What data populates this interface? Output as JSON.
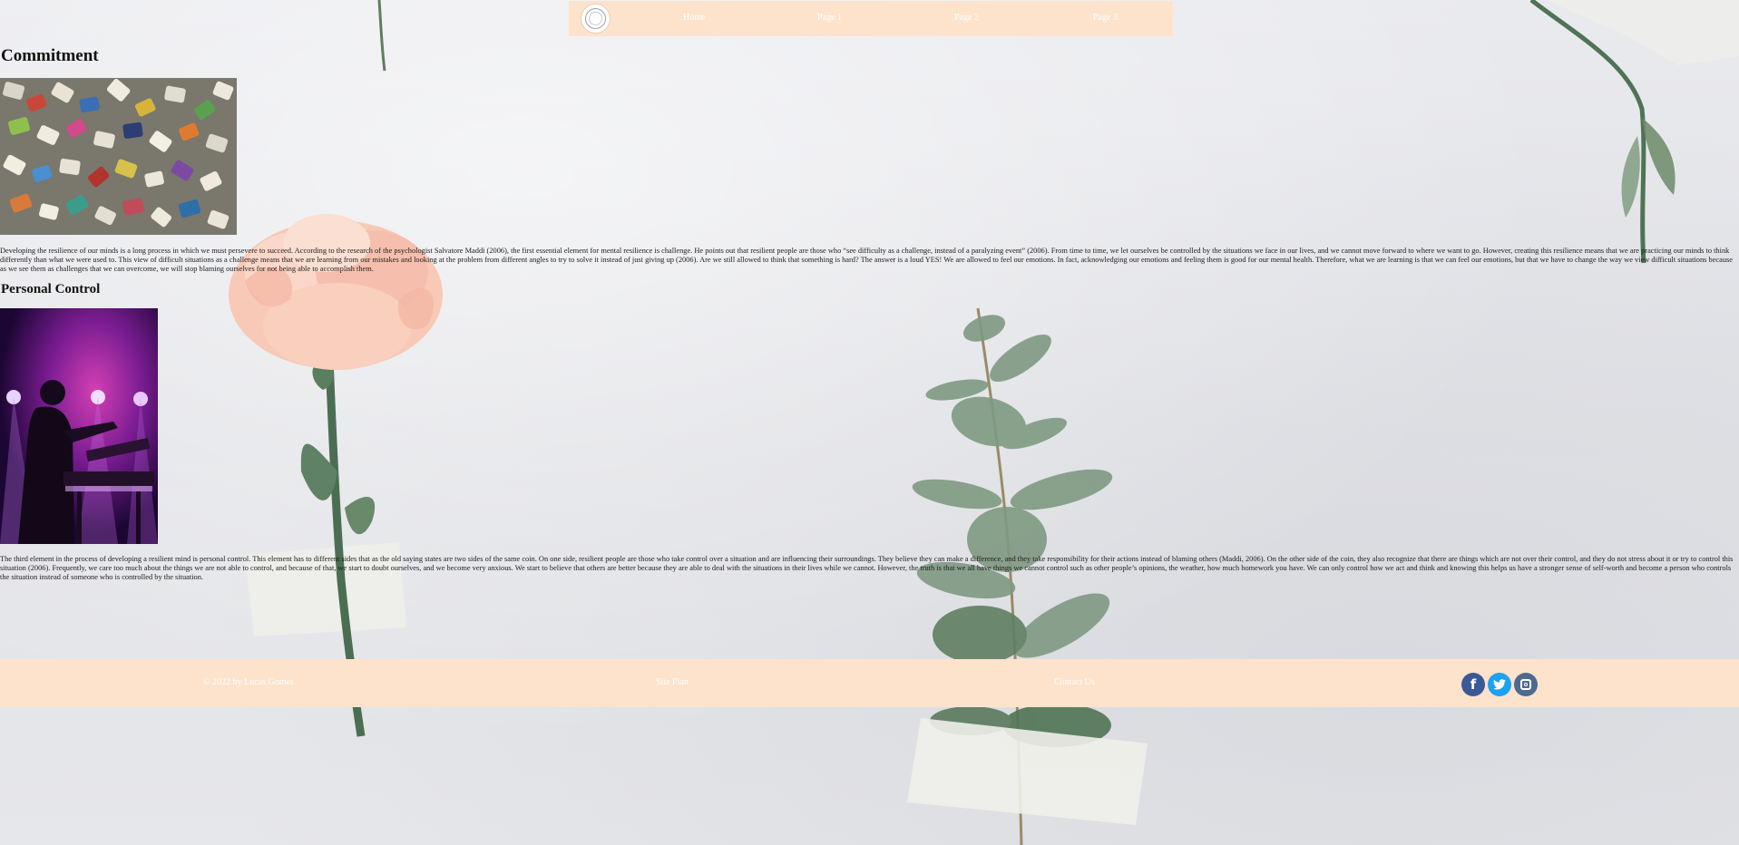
{
  "nav": {
    "logo": "site-logo",
    "links": [
      "Home",
      "Page 1",
      "Page 2",
      "Page 3"
    ]
  },
  "sections": [
    {
      "title": "Commitment",
      "image": "jigsaw-puzzle-pieces-photo",
      "text": "Developing the resilience of our minds is a long process in which we must persevere to succeed. According to the research of the psychologist Salvatore Maddi (2006), the first essential element for mental resilience is challenge. He points out that resilient people are those who “see difficulty as a challenge, instead of a paralyzing event” (2006). From time to time, we let ourselves be controlled by the situations we face in our lives, and we cannot move forward to where we want to go. However, creating this resilience means that we are practicing our minds to think differently than what we were used to. This view of difficult situations as a challenge means that we are learning from our mistakes and looking at the problem from different angles to try to solve it instead of just giving up (2006). Are we still allowed to think that something is hard? The answer is a loud YES! We are allowed to feel our emotions. In fact, acknowledging our emotions and feeling them is good for our mental health. Therefore, what we are learning is that we can feel our emotions, but that we have to change the way we view difficult situations because as we see them as challenges that we can overcome, we will stop blaming ourselves for not being able to accomplish them."
    },
    {
      "title": "Personal Control",
      "image": "musician-at-keyboard-photo",
      "text": "The third element in the process of developing a resilient mind is personal control. This element has to different sides that as the old saying states are two sides of the same coin. On one side, resilient people are those who take control over a situation and are influencing their surroundings. They believe they can make a difference, and they take responsibility for their actions instead of blaming others (Maddi, 2006). On the other side of the coin, they also recognize that there are things which are not over their control, and they do not stress about it or try to control this situation (2006). Frequently, we care too much about the things we are not able to control, and because of that, we start to doubt ourselves, and we become very anxious. We start to believe that others are better because they are able to deal with the situations in their lives while we cannot. However, the truth is that we all have things we cannot control such as other people’s opinions, the weather, how much homework you have. We can only control how we act and think and knowing this helps us have a stronger sense of self-worth and become a person who controls the situation instead of someone who is controlled by the situation."
    }
  ],
  "footer": {
    "copyright": "© 2022 by Lucas Gomes",
    "site_plan": "Site Plan",
    "contact": "Contact Us",
    "social": {
      "facebook_glyph": "f",
      "twitter_glyph": "t",
      "icons": [
        "facebook-icon",
        "twitter-icon",
        "instagram-icon"
      ]
    }
  },
  "colors": {
    "bar": "#fde3cc",
    "bar_text": "#ffffff",
    "wall": "#e4e5e9",
    "facebook": "#3b5998",
    "twitter": "#1da1f2",
    "instagram": "#4d6a8f"
  }
}
